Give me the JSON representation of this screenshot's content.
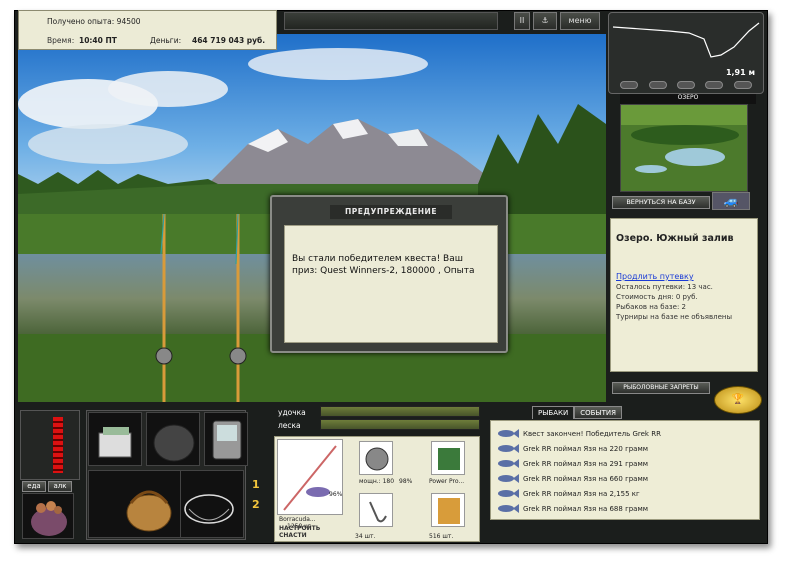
{
  "hud": {
    "experience": "Получено опыта: 94500",
    "time_label": "Время:",
    "time_value": "10:40 ПТ",
    "money_label": "Деньги:",
    "money_value": "464 719 043 руб."
  },
  "top_controls": {
    "pause": "II",
    "menu": "меню"
  },
  "minimap": {
    "depth": "1,91 м",
    "location_title": "ОЗЕРО"
  },
  "nav": {
    "return_to_base": "ВЕРНУТЬСЯ НА БАЗУ",
    "fishing_bans": "РЫБОЛОВНЫЕ ЗАПРЕТЫ"
  },
  "location_panel": {
    "title": "Озеро. Южный залив",
    "extend_link": "Продлить путевку",
    "lines": [
      "Осталось путевки: 13 час.",
      "Стоимость дня: 0 руб.",
      "Рыбаков на базе: 2",
      "Турниры на базе не объявлены"
    ]
  },
  "dialog": {
    "title": "ПРЕДУПРЕЖДЕНИЕ",
    "text": "Вы стали победителем квеста! Ваш приз: Quest Winners-2, 180000 , Опыта"
  },
  "inventory": {
    "food_tab": "еда",
    "alcohol_tab": "алк",
    "rod_number_1": "1",
    "rod_number_2": "2"
  },
  "line_meters": {
    "rod_label": "удочка",
    "line_label": "леска"
  },
  "tackle": {
    "rod_name": "Borracuda...",
    "rod_weight": "1250 кг",
    "rod_percent": "96%",
    "reel_power": "мощн.: 180",
    "reel_percent": "98%",
    "line_name": "Power Pro...",
    "hooks_count": "34 шт.",
    "bait_count": "516 шт.",
    "setup_button": "НАСТРОИТЬ СНАСТИ"
  },
  "chat": {
    "tabs": [
      "РЫБАКИ",
      "СОБЫТИЯ"
    ],
    "messages": [
      "Квест закончен! Победитель Grek RR",
      "Grek RR поймал Язя на 220 грамм",
      "Grek RR поймал Язя на 291 грамм",
      "Grek RR поймал Язя на 660 грамм",
      "Grek RR поймал Язя на 2,155 кг",
      "Grek RR поймал Язя на 688 грамм"
    ]
  },
  "colors": {
    "panel_bg": "#ecebd6",
    "frame_bg": "#1b1e1c",
    "link": "#1a3bd6",
    "accent_gold": "#f3c53c"
  }
}
